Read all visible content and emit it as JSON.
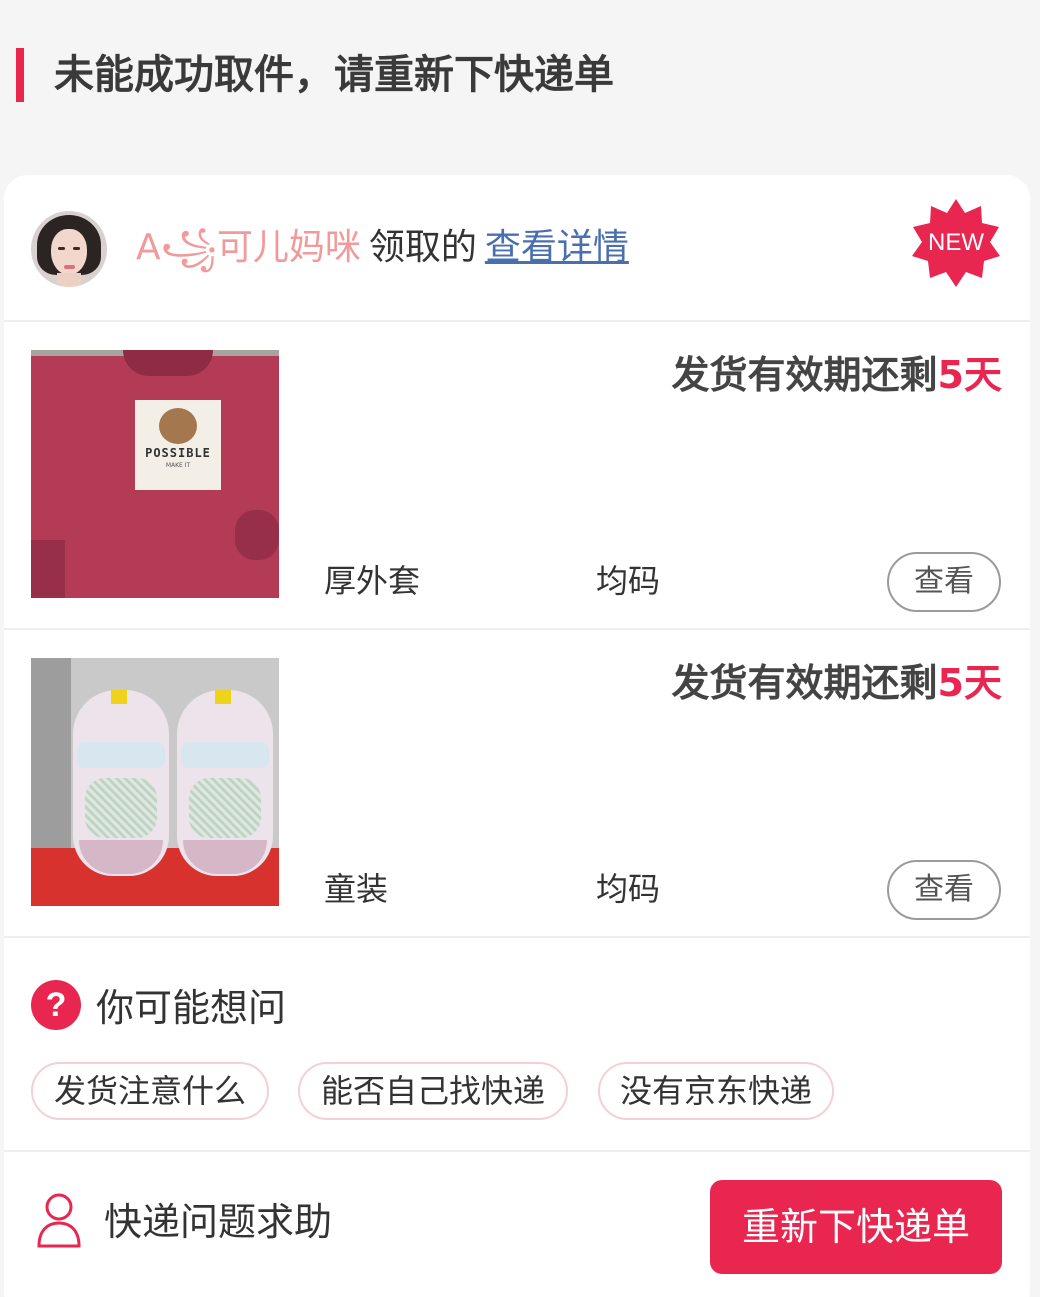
{
  "header": {
    "title": "未能成功取件，请重新下快递单"
  },
  "user": {
    "name": "A꧁可儿妈咪",
    "received_text": "领取的",
    "view_detail_label": "查看详情"
  },
  "badge": {
    "label": "NEW",
    "color": "#e8264f"
  },
  "items": [
    {
      "deadline_prefix": "发货有效期还剩",
      "deadline_days": "5天",
      "category": "厚外套",
      "size": "均码",
      "view_label": "查看",
      "image": "red-sweatshirt-photo"
    },
    {
      "deadline_prefix": "发货有效期还剩",
      "deadline_days": "5天",
      "category": "童装",
      "size": "均码",
      "view_label": "查看",
      "image": "baby-shoes-photo"
    }
  ],
  "faq": {
    "icon": "question-icon",
    "title": "你可能想问",
    "chips": [
      "发货注意什么",
      "能否自己找快递",
      "没有京东快递"
    ]
  },
  "footer": {
    "help_icon": "person-icon",
    "help_label": "快递问题求助",
    "reorder_label": "重新下快递单"
  },
  "colors": {
    "accent": "#e8264f",
    "link": "#4a6fae",
    "username": "#f09a9a"
  }
}
